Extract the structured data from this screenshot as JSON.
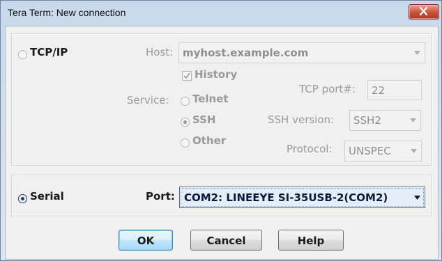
{
  "window": {
    "title": "Tera Term: New connection"
  },
  "tcpip": {
    "radio_label": "TCP/IP",
    "host_label": "Host:",
    "host_value": "myhost.example.com",
    "history_label": "History",
    "service_label": "Service:",
    "service_options": [
      "Telnet",
      "SSH",
      "Other"
    ],
    "tcp_port_label": "TCP port#:",
    "tcp_port_value": "22",
    "ssh_version_label": "SSH version:",
    "ssh_version_value": "SSH2",
    "protocol_label": "Protocol:",
    "protocol_value": "UNSPEC"
  },
  "serial": {
    "radio_label": "Serial",
    "port_label": "Port:",
    "port_value": "COM2: LINEEYE SI-35USB-2(COM2)"
  },
  "buttons": {
    "ok": "OK",
    "cancel": "Cancel",
    "help": "Help"
  },
  "icons": {
    "close": "close-icon",
    "dropdown": "chevron-down-icon",
    "check": "checkmark-icon"
  },
  "colors": {
    "titlebar": "#c9d9ec",
    "close_button": "#c8513a",
    "default_button": "#bee6fd",
    "selection": "#e4eef9"
  }
}
